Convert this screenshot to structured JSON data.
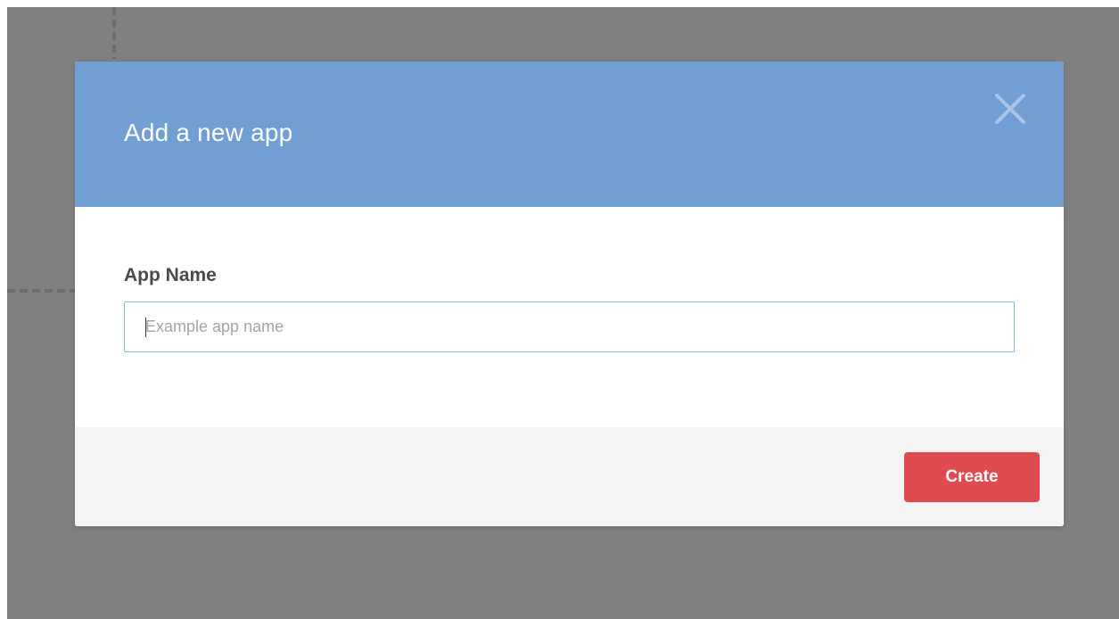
{
  "dialog": {
    "title": "Add a new app",
    "close_icon": "close-icon",
    "header_color": "#719fd3"
  },
  "form": {
    "app_name_label": "App Name",
    "app_name_value": "",
    "app_name_placeholder": "Example app name"
  },
  "footer": {
    "create_label": "Create",
    "create_color": "#e04b4f"
  }
}
